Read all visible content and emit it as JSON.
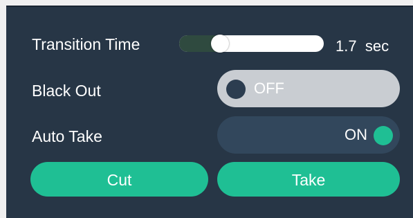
{
  "transition": {
    "label": "Transition Time",
    "value": "1.7",
    "unit": "sec",
    "slider_fraction": 0.25
  },
  "black_out": {
    "label": "Black Out",
    "state": "OFF"
  },
  "auto_take": {
    "label": "Auto Take",
    "state": "ON"
  },
  "buttons": {
    "cut": "Cut",
    "take": "Take"
  },
  "colors": {
    "panel": "#273646",
    "accent": "#1fbf94",
    "toggle_off": "#c9cdd2",
    "toggle_on": "#32475c"
  }
}
